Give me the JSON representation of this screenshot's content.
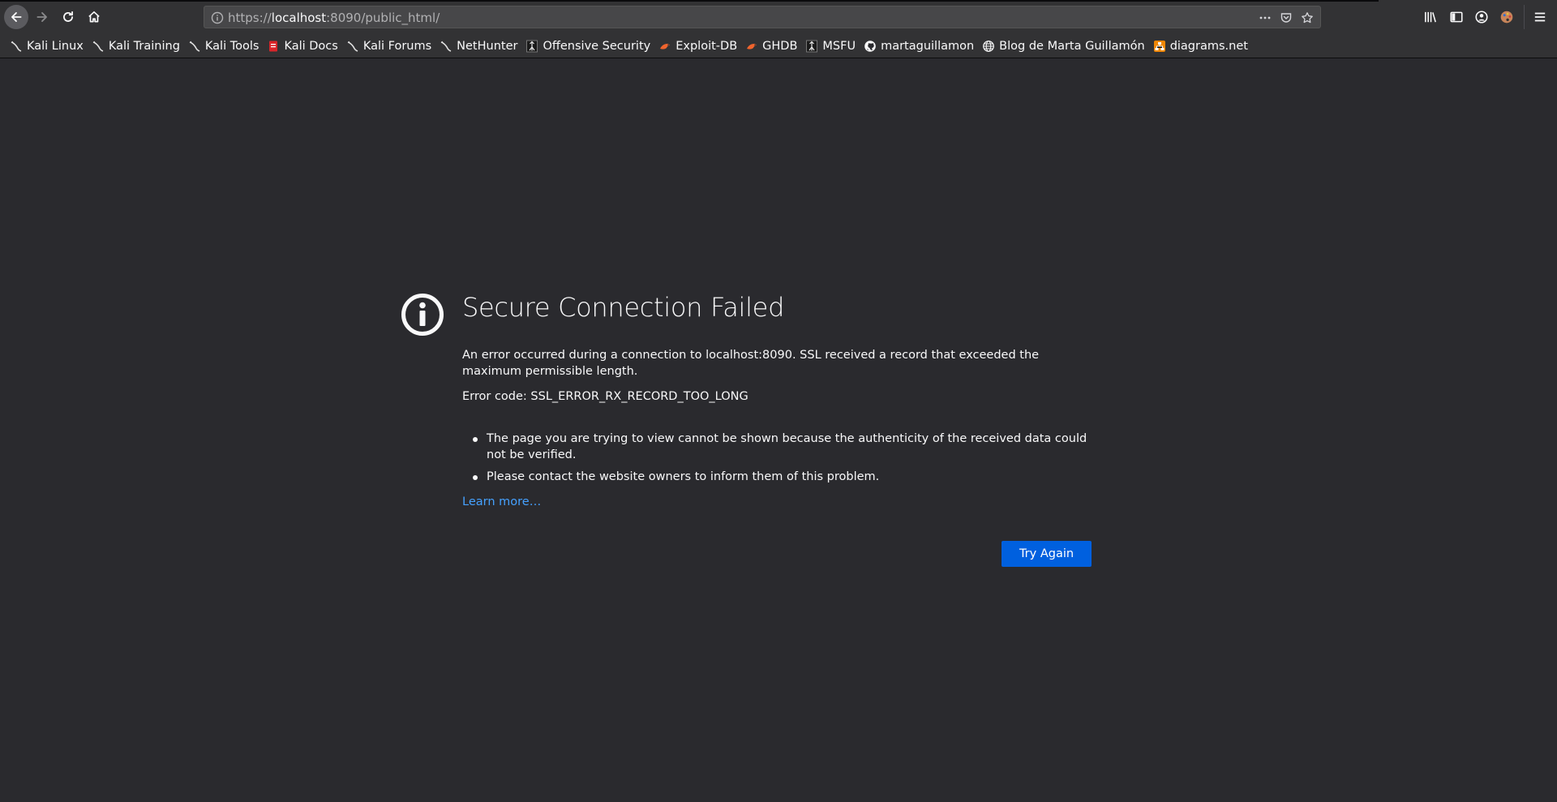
{
  "browser": {
    "url_scheme": "https://",
    "url_host": "localhost",
    "url_rest": ":8090/public_html/"
  },
  "bookmarks": [
    {
      "label": "Kali Linux",
      "icon": "kali-dragon-icon"
    },
    {
      "label": "Kali Training",
      "icon": "kali-dragon-icon"
    },
    {
      "label": "Kali Tools",
      "icon": "kali-dragon-icon"
    },
    {
      "label": "Kali Docs",
      "icon": "kali-docs-icon"
    },
    {
      "label": "Kali Forums",
      "icon": "kali-dragon-icon"
    },
    {
      "label": "NetHunter",
      "icon": "kali-dragon-icon"
    },
    {
      "label": "Offensive Security",
      "icon": "offsec-icon"
    },
    {
      "label": "Exploit-DB",
      "icon": "exploit-db-icon"
    },
    {
      "label": "GHDB",
      "icon": "exploit-db-icon"
    },
    {
      "label": "MSFU",
      "icon": "offsec-icon"
    },
    {
      "label": "martaguillamon",
      "icon": "github-icon"
    },
    {
      "label": "Blog de Marta Guillamón",
      "icon": "globe-icon"
    },
    {
      "label": "diagrams.net",
      "icon": "diagrams-icon"
    }
  ],
  "error": {
    "title": "Secure Connection Failed",
    "description": "An error occurred during a connection to localhost:8090. SSL received a record that exceeded the maximum permissible length.",
    "code_text": "Error code: SSL_ERROR_RX_RECORD_TOO_LONG",
    "bullets": [
      "The page you are trying to view cannot be shown because the authenticity of the received data could not be verified.",
      "Please contact the website owners to inform them of this problem."
    ],
    "learn_more": "Learn more…",
    "try_again": "Try Again"
  },
  "colors": {
    "background": "#2a2a2e",
    "toolbar": "#323234",
    "accent_button": "#0060df",
    "link": "#45a1ff"
  }
}
